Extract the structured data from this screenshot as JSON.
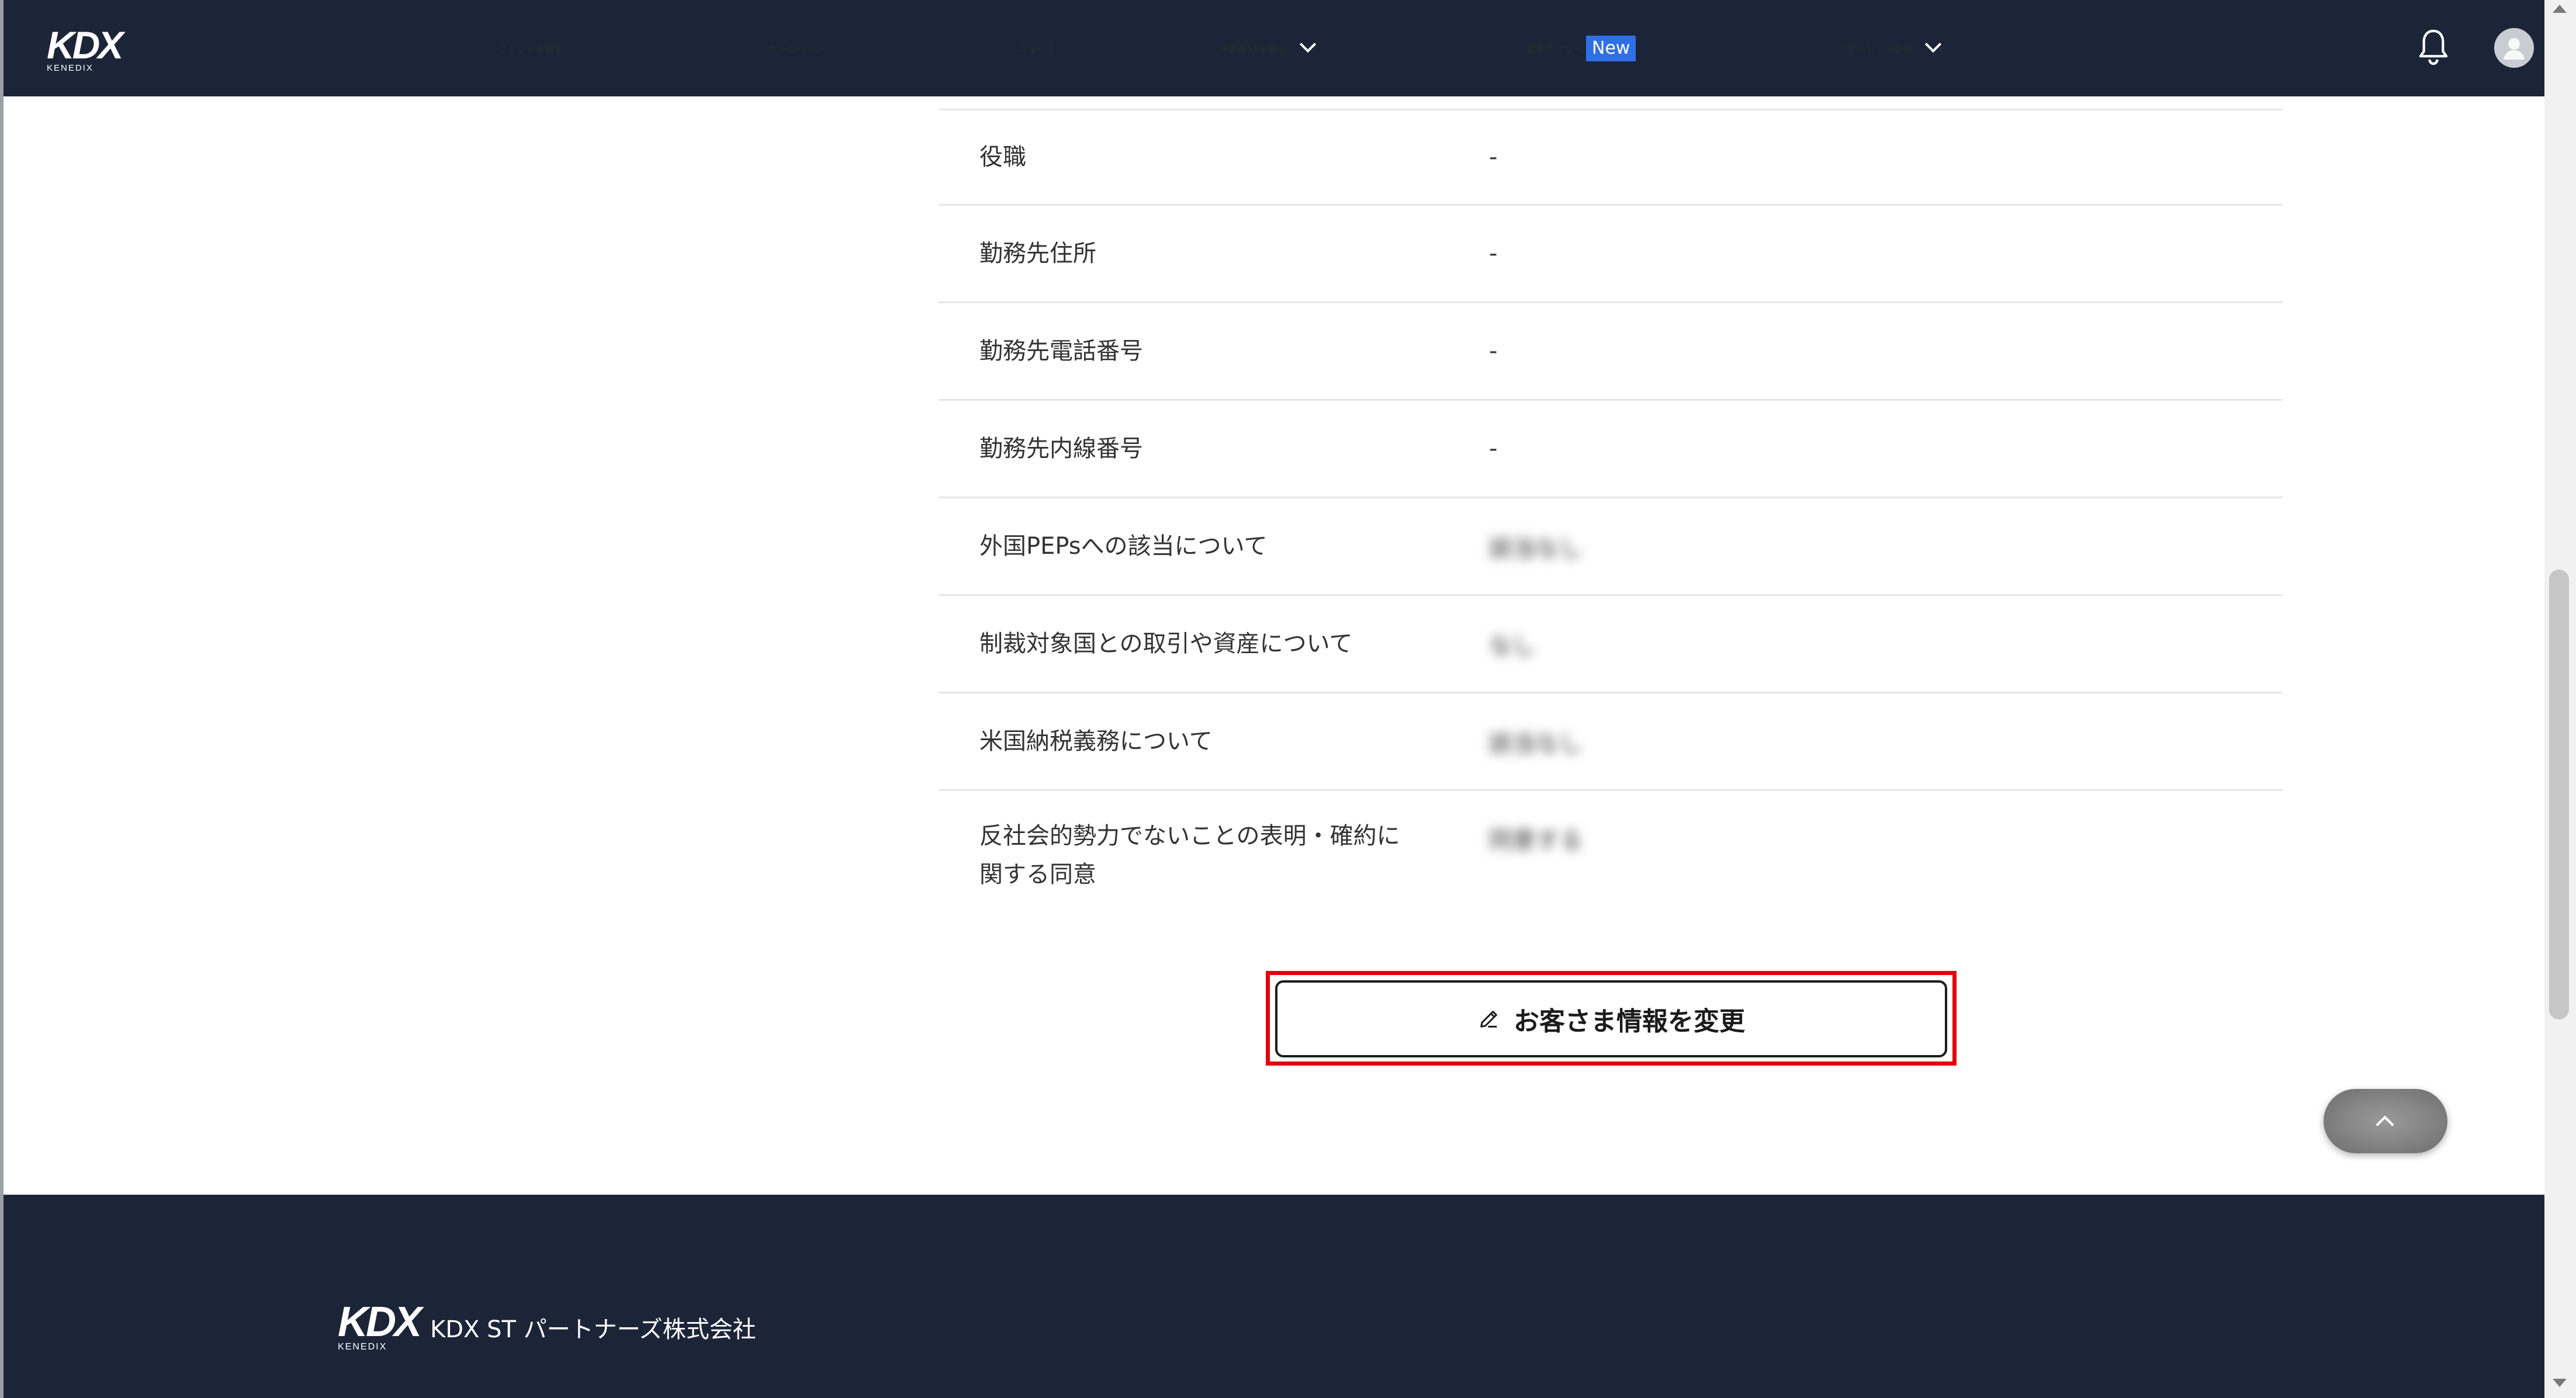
{
  "header": {
    "logo": "KDX",
    "logo_sub": "KENEDIX",
    "nav": [
      {
        "label": "ファンドを探す"
      },
      {
        "label": "キャンペーン"
      },
      {
        "label": "ニュース"
      },
      {
        "label": "不動産STを知る"
      },
      {
        "label": "資産サマリー",
        "badge": "New"
      },
      {
        "label": "サポート・その他"
      }
    ],
    "icons": {
      "notifications": "bell-icon",
      "account": "user-avatar-icon"
    }
  },
  "profile_rows": [
    {
      "label": "役職",
      "value": "-"
    },
    {
      "label": "勤務先住所",
      "value": "-"
    },
    {
      "label": "勤務先電話番号",
      "value": "-"
    },
    {
      "label": "勤務先内線番号",
      "value": "-"
    },
    {
      "label": "外国PEPsへの該当について",
      "value": "該当なし"
    },
    {
      "label": "制裁対象国との取引や資産について",
      "value": "なし"
    },
    {
      "label": "米国納税義務について",
      "value": "該当なし"
    },
    {
      "label": "反社会的勢力でないことの表明・確約に関する同意",
      "value": "同意する"
    }
  ],
  "edit_button": {
    "label": "お客さま情報を変更",
    "icon": "pencil-icon"
  },
  "back_to_top": {
    "icon": "chevron-up-icon"
  },
  "footer": {
    "logo": "KDX",
    "logo_sub": "KENEDIX",
    "company": "KDX ST パートナーズ株式会社"
  }
}
